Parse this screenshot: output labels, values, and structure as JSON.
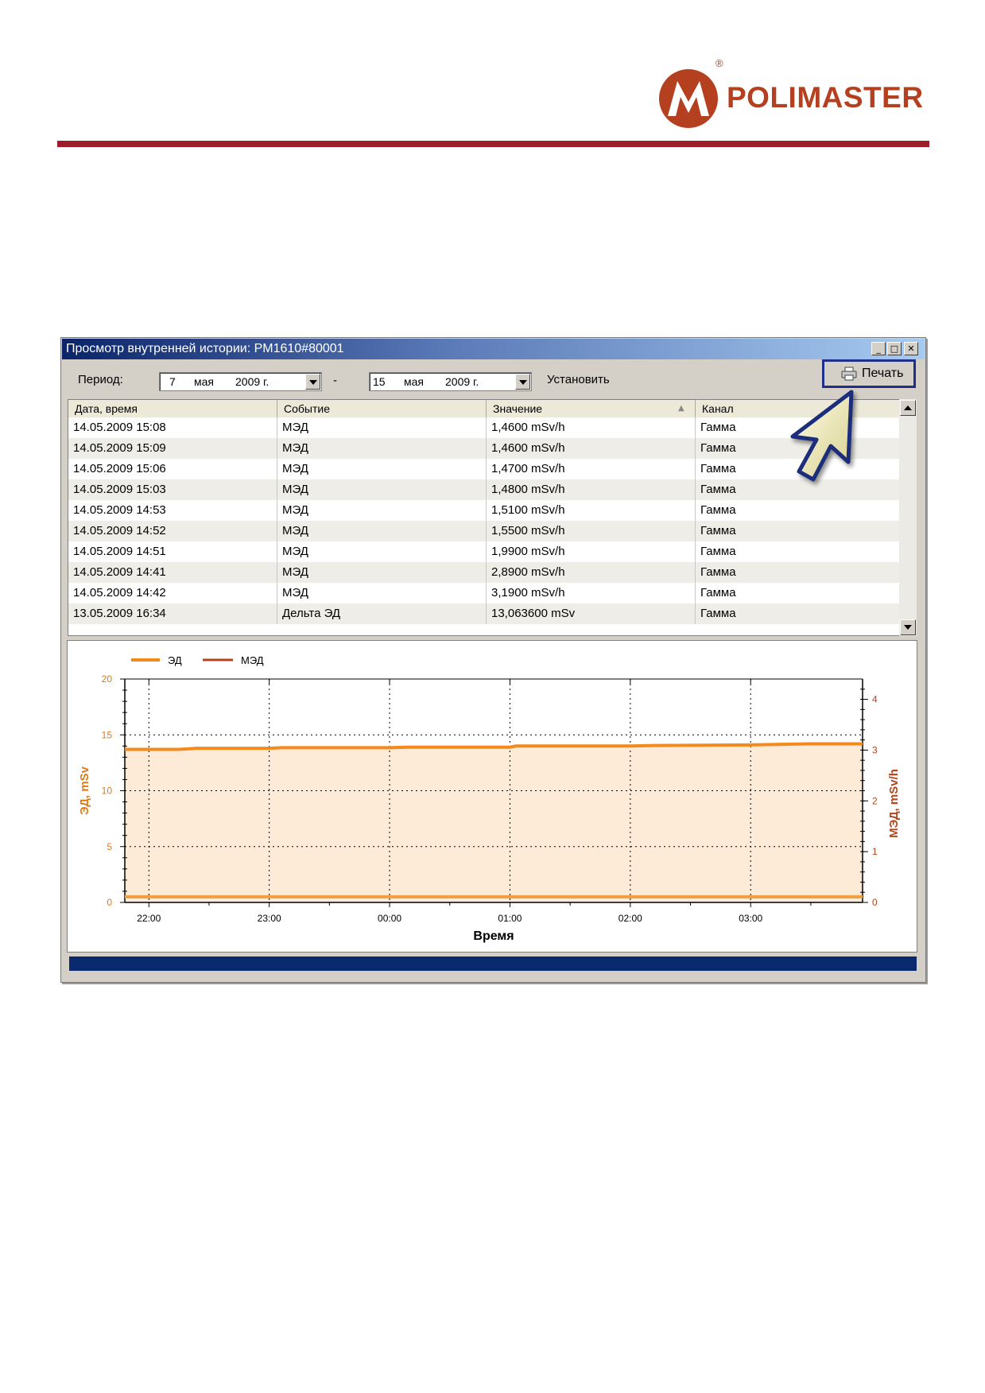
{
  "header": {
    "brand": "POLIMASTER",
    "registered": "®",
    "brand_color": "#b5401f",
    "rule_color": "#a01c2a"
  },
  "window": {
    "title": "Просмотр внутренней истории: PM1610#80001",
    "controls": [
      "minimize",
      "maximize",
      "close"
    ]
  },
  "toolbar": {
    "period_label": "Период:",
    "from": {
      "day": "7",
      "month": "мая",
      "year": "2009 г."
    },
    "dash": "-",
    "to": {
      "day": "15",
      "month": "мая",
      "year": "2009 г."
    },
    "set_button": "Установить",
    "print_button": "Печать"
  },
  "table": {
    "columns": [
      "Дата, время",
      "Событие",
      "Значение",
      "Канал"
    ],
    "rows": [
      [
        "14.05.2009 15:08",
        "МЭД",
        "1,4600 mSv/h",
        "Гамма"
      ],
      [
        "14.05.2009 15:09",
        "МЭД",
        "1,4600 mSv/h",
        "Гамма"
      ],
      [
        "14.05.2009 15:06",
        "МЭД",
        "1,4700 mSv/h",
        "Гамма"
      ],
      [
        "14.05.2009 15:03",
        "МЭД",
        "1,4800 mSv/h",
        "Гамма"
      ],
      [
        "14.05.2009 14:53",
        "МЭД",
        "1,5100 mSv/h",
        "Гамма"
      ],
      [
        "14.05.2009 14:52",
        "МЭД",
        "1,5500 mSv/h",
        "Гамма"
      ],
      [
        "14.05.2009 14:51",
        "МЭД",
        "1,9900 mSv/h",
        "Гамма"
      ],
      [
        "14.05.2009 14:41",
        "МЭД",
        "2,8900 mSv/h",
        "Гамма"
      ],
      [
        "14.05.2009 14:42",
        "МЭД",
        "3,1900 mSv/h",
        "Гамма"
      ],
      [
        "13.05.2009 16:34",
        "Дельта ЭД",
        "13,063600 mSv",
        "Гамма"
      ]
    ]
  },
  "chart_data": {
    "type": "line",
    "xlabel": "Время",
    "ylabel_left": "ЭД, mSv",
    "ylabel_right": "МЭД, mSv/h",
    "ylim_left": [
      0,
      20
    ],
    "ylim_right": [
      0,
      4.4
    ],
    "x_ticks": [
      "22:00",
      "23:00",
      "00:00",
      "01:00",
      "02:00",
      "03:00"
    ],
    "x_hours": [
      21.8,
      22.0,
      22.25,
      22.4,
      23.0,
      23.1,
      23.5,
      24.0,
      24.15,
      25.0,
      25.05,
      25.5,
      26.0,
      26.2,
      27.0,
      27.5,
      27.93
    ],
    "legend": "top-left",
    "grid": true,
    "series": [
      {
        "name": "ЭД",
        "axis": "left",
        "color": "#f4891c",
        "fill": "#fdebd8",
        "values": [
          13.7,
          13.7,
          13.7,
          13.8,
          13.8,
          13.85,
          13.85,
          13.85,
          13.9,
          13.9,
          14.0,
          14.0,
          14.0,
          14.05,
          14.1,
          14.2,
          14.2
        ]
      },
      {
        "name": "МЭД",
        "axis": "right",
        "color": "#b4441b",
        "values": [
          0.11,
          0.11,
          0.11,
          0.11,
          0.11,
          0.11,
          0.11,
          0.11,
          0.11,
          0.11,
          0.11,
          0.11,
          0.11,
          0.11,
          0.11,
          0.11,
          0.11
        ]
      }
    ],
    "y_ticks_left": [
      "0",
      "5",
      "10",
      "15",
      "20"
    ],
    "y_ticks_right": [
      "0",
      "1",
      "2",
      "3",
      "4"
    ]
  }
}
